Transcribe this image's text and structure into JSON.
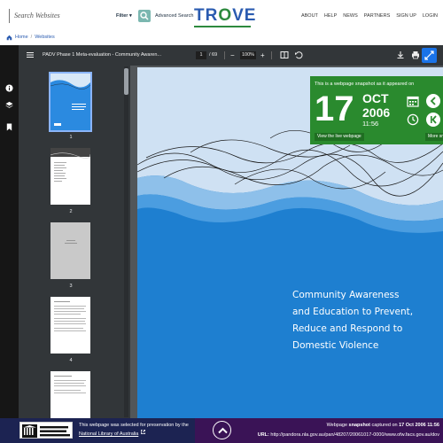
{
  "header": {
    "search_placeholder": "Search Websites",
    "filter_label": "Filter",
    "advanced_search": "Advanced Search",
    "logo_text_a": "TR",
    "logo_text_o": "O",
    "logo_text_b": "VE",
    "nav": [
      "ABOUT",
      "HELP",
      "NEWS",
      "PARTNERS",
      "SIGN UP",
      "LOGIN"
    ]
  },
  "breadcrumb": {
    "home": "Home",
    "separator": "/",
    "current": "Websites"
  },
  "viewer": {
    "title": "PADV Phase 1 Meta-evaluation - Community Awaren...",
    "page_current": "1",
    "page_total": "/ 69",
    "zoom": "100%",
    "minus": "−",
    "plus": "+",
    "thumbnails": [
      "1",
      "2",
      "3",
      "4"
    ]
  },
  "document": {
    "cover_lines": [
      "Community Awareness",
      "and Education to Prevent,",
      "Reduce and Respond to",
      "Domestic Violence"
    ]
  },
  "snapshot": {
    "intro": "This is a webpage snapshot as it appeared on",
    "day": "17",
    "month": "OCT",
    "year": "2006",
    "time": "11:56",
    "view_live": "View the live webpage",
    "more": "More snapshots"
  },
  "footer": {
    "selected_text": "This webpage was selected for preservation by the",
    "nla_link": "National Library of Australia",
    "captured_prefix": "Webpage",
    "captured_word": "snapshot",
    "captured_mid": "captured on",
    "captured_date": "17 Oct 2006 11:56",
    "url_label": "URL:",
    "url_value": "http://pandora.nla.gov.au/pan/48207/20061017-0000/www.ofw.facs.gov.au/dov"
  },
  "colors": {
    "accent_blue": "#1a73e8",
    "snapshot_green": "#2a8a2e",
    "footer_navy": "#1c2352",
    "footer_purple": "#3a1356",
    "cover_blue": "#1e7fd0"
  }
}
